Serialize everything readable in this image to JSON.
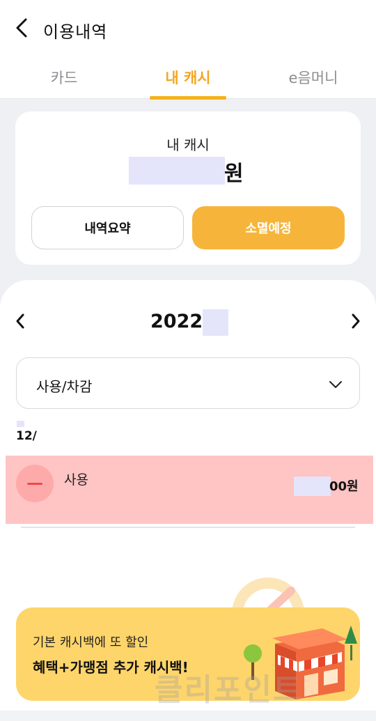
{
  "header": {
    "title": "이용내역",
    "back_icon": "chevron-left-icon"
  },
  "tabs": [
    {
      "label": "카드",
      "active": false
    },
    {
      "label": "내 캐시",
      "active": true
    },
    {
      "label": "e음머니",
      "active": false
    }
  ],
  "summary": {
    "label": "내 캐시",
    "amount_unit": "원",
    "summary_button": "내역요약",
    "expire_button": "소멸예정"
  },
  "history": {
    "month": "2022/",
    "filter": "사용/차감",
    "date": "12/",
    "transactions": [
      {
        "type_label": "사용",
        "amount_suffix": "00원",
        "icon": "minus-icon"
      }
    ]
  },
  "promo": {
    "line1": "기본 캐시백에 또 할인",
    "line2": "혜택+가맹점 추가 캐시백!"
  },
  "watermark": "클리포인트",
  "colors": {
    "accent": "#f5b21b",
    "expire_button": "#f6b53a",
    "promo_bg": "#fdd56a",
    "tx_highlight": "#ffc4c4",
    "redaction": "#e4e4fb"
  }
}
